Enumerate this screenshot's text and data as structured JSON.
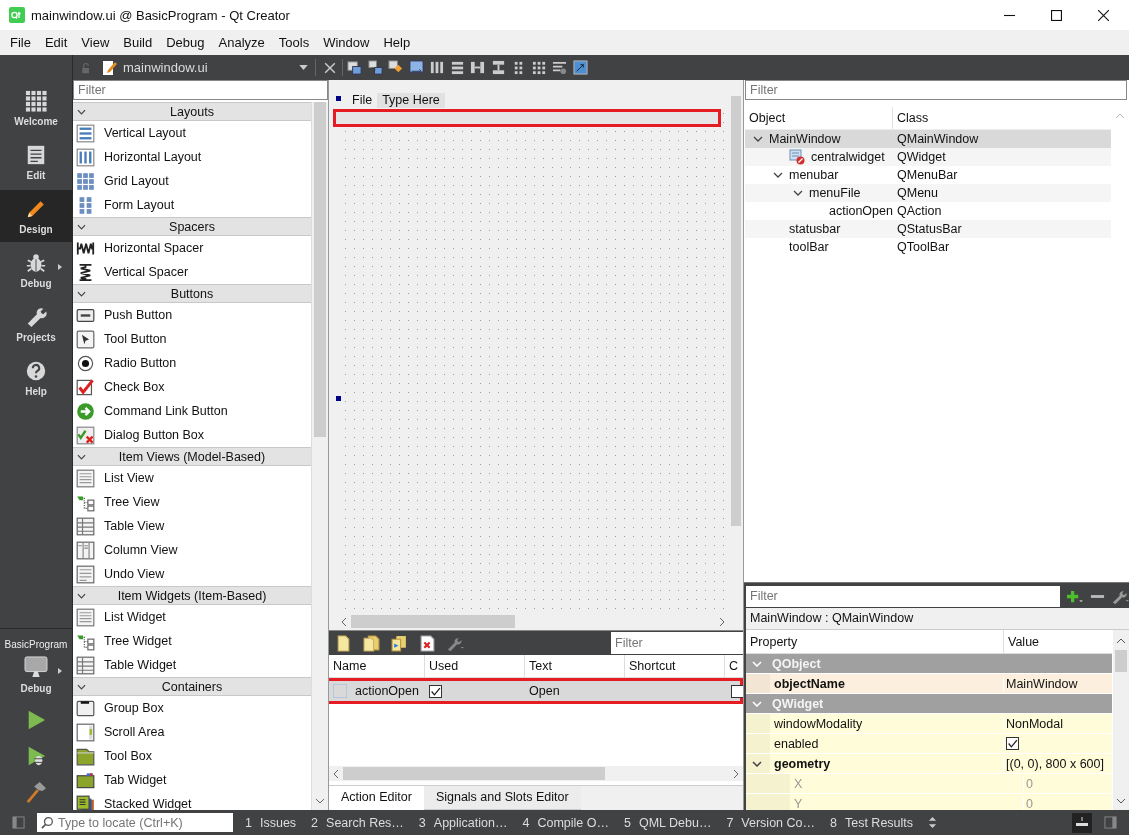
{
  "window": {
    "title": "mainwindow.ui @ BasicProgram - Qt Creator"
  },
  "menu": [
    "File",
    "Edit",
    "View",
    "Build",
    "Debug",
    "Analyze",
    "Tools",
    "Window",
    "Help"
  ],
  "editor_bar": {
    "file": "mainwindow.ui"
  },
  "mode_bar": {
    "modes": [
      {
        "label": "Welcome",
        "kind": "welcome",
        "selected": false
      },
      {
        "label": "Edit",
        "kind": "edit",
        "selected": false
      },
      {
        "label": "Design",
        "kind": "design",
        "selected": true
      },
      {
        "label": "Debug",
        "kind": "debug",
        "selected": false
      },
      {
        "label": "Projects",
        "kind": "projects",
        "selected": false
      },
      {
        "label": "Help",
        "kind": "help",
        "selected": false
      }
    ],
    "project": "BasicProgram",
    "build_config": "Debug"
  },
  "widget_box": {
    "filter_placeholder": "Filter",
    "categories": [
      {
        "title": "Layouts",
        "expanded": true,
        "items": [
          {
            "label": "Vertical Layout",
            "kind": "vlayout"
          },
          {
            "label": "Horizontal Layout",
            "kind": "hlayout"
          },
          {
            "label": "Grid Layout",
            "kind": "grid"
          },
          {
            "label": "Form Layout",
            "kind": "form"
          }
        ]
      },
      {
        "title": "Spacers",
        "expanded": true,
        "items": [
          {
            "label": "Horizontal Spacer",
            "kind": "hspacer"
          },
          {
            "label": "Vertical Spacer",
            "kind": "vspacer"
          }
        ]
      },
      {
        "title": "Buttons",
        "expanded": true,
        "items": [
          {
            "label": "Push Button",
            "kind": "push"
          },
          {
            "label": "Tool Button",
            "kind": "tool"
          },
          {
            "label": "Radio Button",
            "kind": "radio"
          },
          {
            "label": "Check Box",
            "kind": "check"
          },
          {
            "label": "Command Link Button",
            "kind": "link"
          },
          {
            "label": "Dialog Button Box",
            "kind": "dialog"
          }
        ]
      },
      {
        "title": "Item Views (Model-Based)",
        "expanded": true,
        "items": [
          {
            "label": "List View",
            "kind": "list"
          },
          {
            "label": "Tree View",
            "kind": "tree"
          },
          {
            "label": "Table View",
            "kind": "table"
          },
          {
            "label": "Column View",
            "kind": "column"
          },
          {
            "label": "Undo View",
            "kind": "undo"
          }
        ]
      },
      {
        "title": "Item Widgets (Item-Based)",
        "expanded": true,
        "items": [
          {
            "label": "List Widget",
            "kind": "list"
          },
          {
            "label": "Tree Widget",
            "kind": "tree"
          },
          {
            "label": "Table Widget",
            "kind": "table"
          }
        ]
      },
      {
        "title": "Containers",
        "expanded": true,
        "items": [
          {
            "label": "Group Box",
            "kind": "group"
          },
          {
            "label": "Scroll Area",
            "kind": "scroll"
          },
          {
            "label": "Tool Box",
            "kind": "toolbox"
          },
          {
            "label": "Tab Widget",
            "kind": "tabs"
          },
          {
            "label": "Stacked Widget",
            "kind": "stacked"
          }
        ]
      }
    ]
  },
  "form": {
    "menu_items": [
      {
        "label": "File",
        "kind": "menu"
      },
      {
        "label": "Type Here",
        "kind": "placeholder"
      }
    ],
    "toolbar_highlighted": true
  },
  "action_editor": {
    "filter_placeholder": "Filter",
    "columns": [
      "Name",
      "Used",
      "Text",
      "Shortcut",
      "C"
    ],
    "rows": [
      {
        "name": "actionOpen",
        "used": true,
        "text": "Open",
        "checkable": false,
        "selected": true,
        "highlighted": true
      }
    ],
    "tabs": [
      {
        "label": "Action Editor",
        "selected": true
      },
      {
        "label": "Signals and Slots Editor",
        "selected": false
      }
    ]
  },
  "object_inspector": {
    "filter_placeholder": "Filter",
    "columns": [
      "Object",
      "Class"
    ],
    "rows": [
      {
        "object": "MainWindow",
        "class": "QMainWindow",
        "selected": true,
        "expanded": true,
        "children": [
          {
            "object": "centralwidget",
            "class": "QWidget",
            "kind": "container",
            "selected": false
          },
          {
            "object": "menubar",
            "class": "QMenuBar",
            "selected": false,
            "expanded": true,
            "children": [
              {
                "object": "menuFile",
                "class": "QMenu",
                "selected": false,
                "expanded": true,
                "children": [
                  {
                    "object": "actionOpen",
                    "class": "QAction",
                    "selected": false
                  }
                ]
              }
            ]
          },
          {
            "object": "statusbar",
            "class": "QStatusBar",
            "selected": false
          },
          {
            "object": "toolBar",
            "class": "QToolBar",
            "selected": false
          }
        ]
      }
    ]
  },
  "property_editor": {
    "filter_placeholder": "Filter",
    "object_label": "MainWindow : QMainWindow",
    "columns": [
      "Property",
      "Value"
    ],
    "sections": [
      {
        "title": "QObject",
        "expanded": true,
        "properties": [
          {
            "name": "objectName",
            "kind": "text",
            "value": "MainWindow",
            "changed": true
          }
        ]
      },
      {
        "title": "QWidget",
        "expanded": true,
        "properties": [
          {
            "name": "windowModality",
            "kind": "text",
            "value": "NonModal",
            "changed": false
          },
          {
            "name": "enabled",
            "kind": "checkbox",
            "checked": true,
            "changed": false
          },
          {
            "name": "geometry",
            "kind": "text",
            "value": "[(0, 0), 800 x 600]",
            "changed": true,
            "expanded": true,
            "children": [
              {
                "name": "X",
                "kind": "text",
                "value": "0",
                "changed": false,
                "disabled": true
              },
              {
                "name": "Y",
                "kind": "text",
                "value": "0",
                "changed": false,
                "disabled": true
              }
            ]
          }
        ]
      }
    ]
  },
  "status_bar": {
    "locator_placeholder": "Type to locate (Ctrl+K)",
    "panes": [
      {
        "number": "1",
        "label": "Issues"
      },
      {
        "number": "2",
        "label": "Search Res…"
      },
      {
        "number": "3",
        "label": "Application…"
      },
      {
        "number": "4",
        "label": "Compile O…"
      },
      {
        "number": "5",
        "label": "QML Debu…"
      },
      {
        "number": "7",
        "label": "Version Co…"
      },
      {
        "number": "8",
        "label": "Test Results"
      }
    ]
  }
}
